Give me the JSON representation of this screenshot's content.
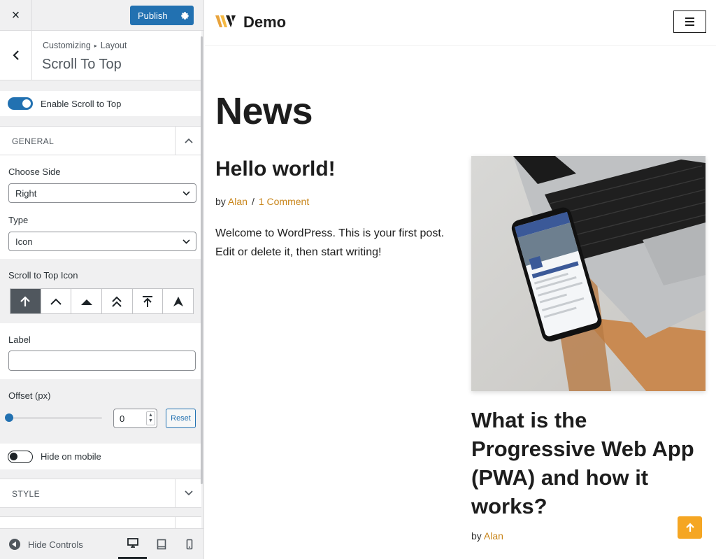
{
  "sidebar": {
    "close_label": "×",
    "publish_label": "Publish",
    "breadcrumb": {
      "root": "Customizing",
      "separator": "▸",
      "parent": "Layout"
    },
    "section_title": "Scroll To Top",
    "enable_toggle": {
      "label": "Enable Scroll to Top",
      "state": "on"
    },
    "general_section": {
      "title": "GENERAL",
      "state": "expanded"
    },
    "choose_side": {
      "label": "Choose Side",
      "value": "Right"
    },
    "type": {
      "label": "Type",
      "value": "Icon"
    },
    "scroll_icon": {
      "label": "Scroll to Top Icon",
      "options": [
        "arrow-up-icon",
        "chevron-up-icon",
        "triangle-up-icon",
        "double-chevron-up-icon",
        "arrow-to-top-icon",
        "arrowhead-up-icon"
      ],
      "selected_index": 0
    },
    "label_field": {
      "label": "Label",
      "value": ""
    },
    "offset": {
      "label": "Offset (px)",
      "value": "0",
      "slider_fraction": 0,
      "reset_label": "Reset"
    },
    "hide_mobile_toggle": {
      "label": "Hide on mobile",
      "state": "off"
    },
    "style_section": {
      "title": "STYLE",
      "state": "collapsed"
    },
    "footer": {
      "hide_controls_label": "Hide Controls",
      "devices": [
        "desktop-icon",
        "tablet-icon",
        "mobile-icon"
      ],
      "active_device": "desktop"
    }
  },
  "preview": {
    "site_title": "Demo",
    "page_title": "News",
    "posts": [
      {
        "title": "Hello world!",
        "by": "by",
        "author": "Alan",
        "separator": "/",
        "comments": "1 Comment",
        "excerpt": "Welcome to WordPress. This is your first post. Edit or delete it, then start writing!"
      },
      {
        "title": "What is the Progressive Web App (PWA) and how it works?",
        "by": "by",
        "author": "Alan"
      }
    ]
  },
  "colors": {
    "accent": "#2271b1",
    "link": "#c8851a",
    "scroll_button": "#f5a623",
    "text": "#1d1d1d"
  }
}
